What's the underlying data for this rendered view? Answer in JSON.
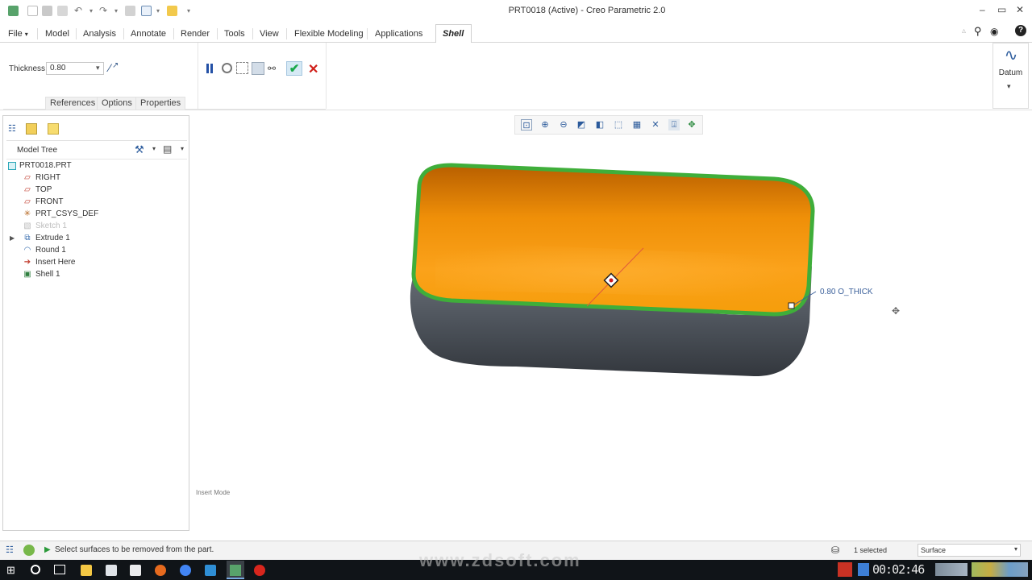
{
  "window": {
    "title": "PRT0018 (Active) - Creo Parametric 2.0"
  },
  "menu": {
    "tabs": [
      "File",
      "Model",
      "Analysis",
      "Annotate",
      "Render",
      "Tools",
      "View",
      "Flexible Modeling",
      "Applications",
      "Shell"
    ],
    "active_tab": "Shell"
  },
  "ribbon": {
    "thickness_label": "Thickness",
    "thickness_value": "0.80",
    "subtabs": [
      "References",
      "Options",
      "Properties"
    ],
    "datum_label": "Datum"
  },
  "model_tree": {
    "header": "Model Tree",
    "items": [
      "PRT0018.PRT",
      "RIGHT",
      "TOP",
      "FRONT",
      "PRT_CSYS_DEF",
      "Sketch 1",
      "Extrude 1",
      "Round 1",
      "Insert Here",
      "Shell 1"
    ]
  },
  "viewport": {
    "dimension_label": "0.80 O_THICK",
    "mode_label": "Insert Mode"
  },
  "statusbar": {
    "message": "Select surfaces to be removed from the part.",
    "selected": "1 selected",
    "filter": "Surface"
  },
  "taskbar": {
    "watermark": "www.zdsoft.com",
    "clock": "00:02:46"
  },
  "colors": {
    "shell_orange": "#f59d0a",
    "edge_green": "#3fae3a",
    "body_gray": "#4e545c",
    "ok_green": "#1aa84a",
    "cancel_red": "#d0201a",
    "dim_blue": "#3a5f9a"
  }
}
